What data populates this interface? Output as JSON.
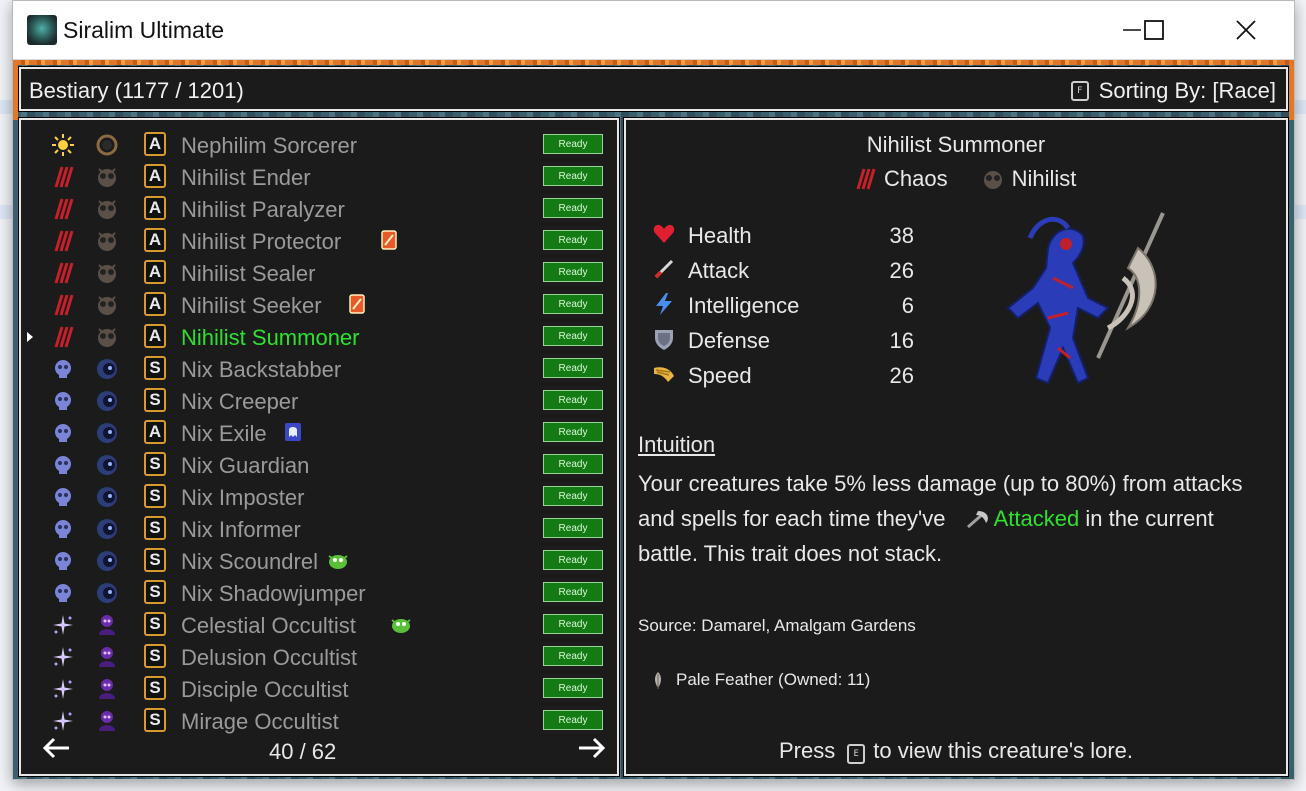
{
  "window": {
    "title": "Siralim Ultimate",
    "controls": {
      "minimize": "minimize-icon",
      "maximize": "maximize-icon",
      "close": "close-icon"
    }
  },
  "header": {
    "title": "Bestiary (1177 / 1201)",
    "sort_key": "F",
    "sort_label": "Sorting By: [Race]"
  },
  "list": {
    "rows": [
      {
        "name": "Nephilim Sorcerer",
        "class": "A",
        "element": "life-icon",
        "race": "nephilim-icon",
        "extra": "",
        "status": "Ready",
        "selected": false
      },
      {
        "name": "Nihilist Ender",
        "class": "A",
        "element": "chaos-icon",
        "race": "nihilist-icon",
        "extra": "",
        "status": "Ready",
        "selected": false
      },
      {
        "name": "Nihilist Paralyzer",
        "class": "A",
        "element": "chaos-icon",
        "race": "nihilist-icon",
        "extra": "",
        "status": "Ready",
        "selected": false
      },
      {
        "name": "Nihilist Protector",
        "class": "A",
        "element": "chaos-icon",
        "race": "nihilist-icon",
        "extra": "card-icon",
        "status": "Ready",
        "selected": false
      },
      {
        "name": "Nihilist Sealer",
        "class": "A",
        "element": "chaos-icon",
        "race": "nihilist-icon",
        "extra": "",
        "status": "Ready",
        "selected": false
      },
      {
        "name": "Nihilist Seeker",
        "class": "A",
        "element": "chaos-icon",
        "race": "nihilist-icon",
        "extra": "card-icon",
        "status": "Ready",
        "selected": false
      },
      {
        "name": "Nihilist Summoner",
        "class": "A",
        "element": "chaos-icon",
        "race": "nihilist-icon",
        "extra": "",
        "status": "Ready",
        "selected": true
      },
      {
        "name": "Nix Backstabber",
        "class": "S",
        "element": "death-icon",
        "race": "nix-icon",
        "extra": "",
        "status": "Ready",
        "selected": false
      },
      {
        "name": "Nix Creeper",
        "class": "S",
        "element": "death-icon",
        "race": "nix-icon",
        "extra": "",
        "status": "Ready",
        "selected": false
      },
      {
        "name": "Nix Exile",
        "class": "A",
        "element": "death-icon",
        "race": "nix-icon",
        "extra": "ghost-icon",
        "status": "Ready",
        "selected": false
      },
      {
        "name": "Nix Guardian",
        "class": "S",
        "element": "death-icon",
        "race": "nix-icon",
        "extra": "",
        "status": "Ready",
        "selected": false
      },
      {
        "name": "Nix Imposter",
        "class": "S",
        "element": "death-icon",
        "race": "nix-icon",
        "extra": "",
        "status": "Ready",
        "selected": false
      },
      {
        "name": "Nix Informer",
        "class": "S",
        "element": "death-icon",
        "race": "nix-icon",
        "extra": "",
        "status": "Ready",
        "selected": false
      },
      {
        "name": "Nix Scoundrel",
        "class": "S",
        "element": "death-icon",
        "race": "nix-icon",
        "extra": "goblin-icon",
        "status": "Ready",
        "selected": false
      },
      {
        "name": "Nix Shadowjumper",
        "class": "S",
        "element": "death-icon",
        "race": "nix-icon",
        "extra": "",
        "status": "Ready",
        "selected": false
      },
      {
        "name": "Celestial Occultist",
        "class": "S",
        "element": "sorcery-icon",
        "race": "occultist-icon",
        "extra": "goblin-icon",
        "status": "Ready",
        "selected": false
      },
      {
        "name": "Delusion Occultist",
        "class": "S",
        "element": "sorcery-icon",
        "race": "occultist-icon",
        "extra": "",
        "status": "Ready",
        "selected": false
      },
      {
        "name": "Disciple Occultist",
        "class": "S",
        "element": "sorcery-icon",
        "race": "occultist-icon",
        "extra": "",
        "status": "Ready",
        "selected": false
      },
      {
        "name": "Mirage Occultist",
        "class": "S",
        "element": "sorcery-icon",
        "race": "occultist-icon",
        "extra": "",
        "status": "Ready",
        "selected": false
      }
    ],
    "page": "40 / 62"
  },
  "detail": {
    "name": "Nihilist Summoner",
    "element": "Chaos",
    "race": "Nihilist",
    "stats": [
      {
        "label": "Health",
        "value": "38",
        "icon": "heart-icon"
      },
      {
        "label": "Attack",
        "value": "26",
        "icon": "sword-icon"
      },
      {
        "label": "Intelligence",
        "value": "6",
        "icon": "lightning-icon"
      },
      {
        "label": "Defense",
        "value": "16",
        "icon": "shield-icon"
      },
      {
        "label": "Speed",
        "value": "26",
        "icon": "wing-icon"
      }
    ],
    "trait_name": "Intuition",
    "trait_desc_1": "Your creatures take 5% less damage (up to 80%) from attacks and spells for each time they've",
    "trait_keyword": "Attacked",
    "trait_desc_2": "in the current battle. This trait does not stack.",
    "source": "Source: Damarel, Amalgam Gardens",
    "material": "Pale Feather (Owned: 11)",
    "lore_press": "Press",
    "lore_key": "E",
    "lore_rest": "to view this creature's lore."
  },
  "colors": {
    "selected": "#2fe02f",
    "ready_bg": "#137a14",
    "class_border": "#d99b2b"
  }
}
